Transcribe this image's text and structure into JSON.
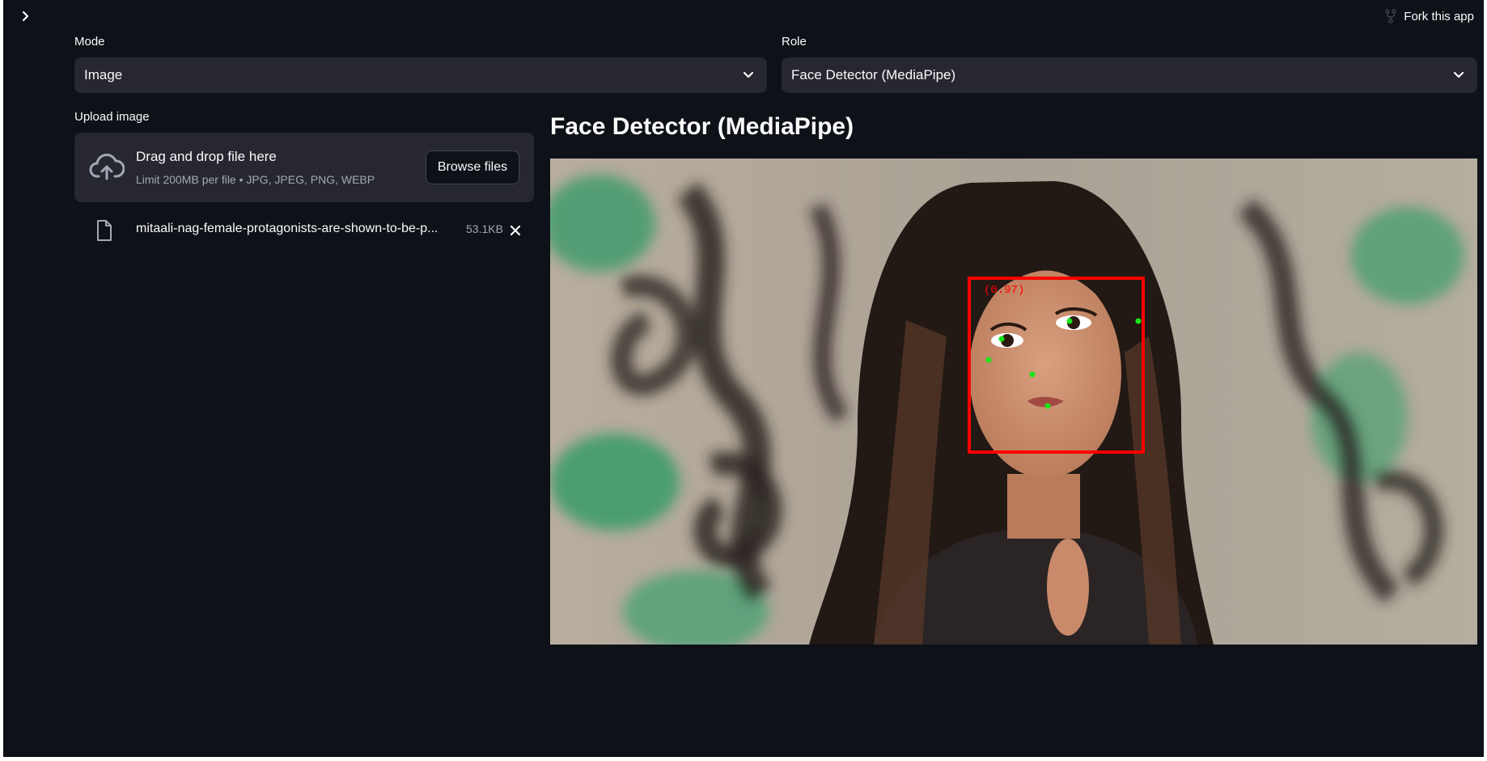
{
  "sidebar": {
    "toggle_icon": "chevron-right-icon"
  },
  "header": {
    "fork_label": "Fork this app",
    "fork_icon": "fork-icon"
  },
  "controls": {
    "mode": {
      "label": "Mode",
      "value": "Image"
    },
    "role": {
      "label": "Role",
      "value": "Face Detector (MediaPipe)"
    }
  },
  "uploader": {
    "label": "Upload image",
    "drop_title": "Drag and drop file here",
    "limit_text": "Limit 200MB per file • JPG, JPEG, PNG, WEBP",
    "browse_label": "Browse files",
    "upload_icon": "cloud-upload-icon",
    "file": {
      "name": "mitaali-nag-female-protagonists-are-shown-to-be-p...",
      "size": "53.1KB",
      "icon": "file-icon",
      "remove_icon": "close-icon"
    }
  },
  "result": {
    "heading": "Face Detector (MediaPipe)",
    "detection": {
      "score_label": "(0.97)",
      "box_color": "#ff0000",
      "keypoint_color": "#19e619"
    }
  },
  "colors": {
    "background": "#0e1117",
    "widget": "#262730",
    "text": "#fafafa",
    "muted_text": "#a3a8b4"
  }
}
